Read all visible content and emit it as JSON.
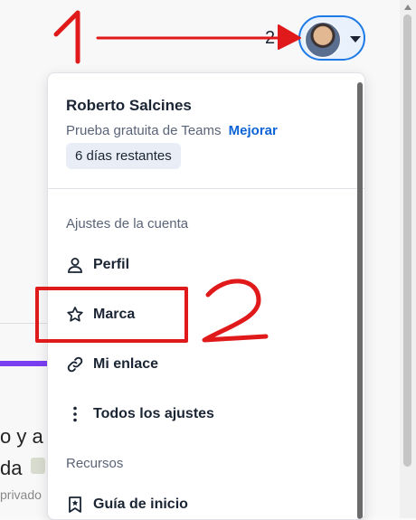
{
  "header": {
    "user_count": "2",
    "avatar_icon": "user-avatar-photo"
  },
  "background": {
    "line1": "o y a",
    "line2": "da",
    "line3": "privado"
  },
  "menu": {
    "user_name": "Roberto Salcines",
    "plan_text": "Prueba gratuita de Teams",
    "upgrade_label": "Mejorar",
    "trial_badge": "6 días restantes",
    "account_section": "Ajustes de la cuenta",
    "items": [
      {
        "label": "Perfil",
        "icon": "user-icon"
      },
      {
        "label": "Marca",
        "icon": "star-icon"
      },
      {
        "label": "Mi enlace",
        "icon": "link-icon"
      },
      {
        "label": "Todos los ajustes",
        "icon": "more-vertical-icon"
      }
    ],
    "resources_section": "Recursos",
    "resources_items": [
      {
        "label": "Guía de inicio",
        "icon": "bookmark-star-icon"
      }
    ]
  },
  "annotations": {
    "label1": "1",
    "label2": "2",
    "color": "#e0191b"
  },
  "colors": {
    "accent": "#1e7ae6",
    "link": "#0b63d6",
    "brand_purple": "#7b3ff2"
  }
}
